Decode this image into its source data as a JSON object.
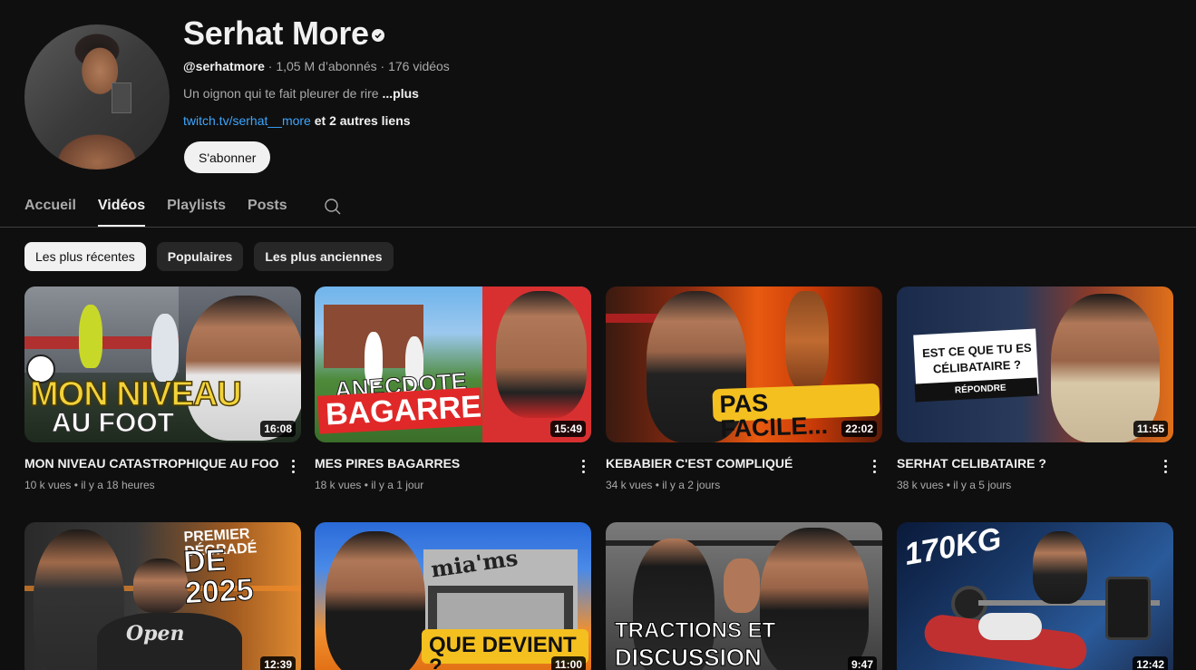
{
  "channel": {
    "name": "Serhat More",
    "handle": "@serhatmore",
    "subscribers": " · 1,05 M d’abonnés · 176 vidéos",
    "description": "Un oignon qui te fait pleurer de rire ",
    "description_more": "...plus",
    "link": "twitch.tv/serhat__more",
    "other_links": " et 2 autres liens",
    "subscribe_label": "S'abonner"
  },
  "tabs": [
    {
      "label": "Accueil",
      "active": false
    },
    {
      "label": "Vidéos",
      "active": true
    },
    {
      "label": "Playlists",
      "active": false
    },
    {
      "label": "Posts",
      "active": false
    }
  ],
  "chips": [
    {
      "label": "Les plus récentes",
      "selected": true
    },
    {
      "label": "Populaires",
      "selected": false
    },
    {
      "label": "Les plus anciennes",
      "selected": false
    }
  ],
  "videos": [
    {
      "title": "MON NIVEAU CATASTROPHIQUE AU FOOT",
      "views": "10 k vues",
      "age": "il y a 18 heures",
      "duration": "16:08",
      "thumb_text": [
        "MON NIVEAU",
        "AU FOOT"
      ]
    },
    {
      "title": "MES PIRES BAGARRES",
      "views": "18 k vues",
      "age": "il y a 1 jour",
      "duration": "15:49",
      "thumb_text": [
        "ANECDOTE",
        "BAGARRE"
      ]
    },
    {
      "title": "KEBABIER C'EST COMPLIQUÉ",
      "views": "34 k vues",
      "age": "il y a 2 jours",
      "duration": "22:02",
      "thumb_text": [
        "PAS FACILE..."
      ]
    },
    {
      "title": "SERHAT CELIBATAIRE ?",
      "views": "38 k vues",
      "age": "il y a 5 jours",
      "duration": "11:55",
      "thumb_text": [
        "EST CE QUE TU ES",
        "CÉLIBATAIRE ?",
        "RÉPONDRE"
      ]
    },
    {
      "title": "",
      "views": "",
      "age": "",
      "duration": "12:39",
      "thumb_text": [
        "PREMIER DÉGRADÉ",
        "DE 2025",
        "Open"
      ]
    },
    {
      "title": "",
      "views": "",
      "age": "",
      "duration": "11:00",
      "thumb_text": [
        "mia'ms",
        "QUE DEVIENT ?"
      ]
    },
    {
      "title": "",
      "views": "",
      "age": "",
      "duration": "9:47",
      "thumb_text": [
        "TRACTIONS ET",
        "DISCUSSION"
      ]
    },
    {
      "title": "",
      "views": "",
      "age": "",
      "duration": "12:42",
      "thumb_text": [
        "170KG"
      ]
    }
  ],
  "meta_separator": " • ",
  "colors": {
    "background": "#0f0f0f",
    "link": "#3ea6ff",
    "chip": "#272727"
  }
}
